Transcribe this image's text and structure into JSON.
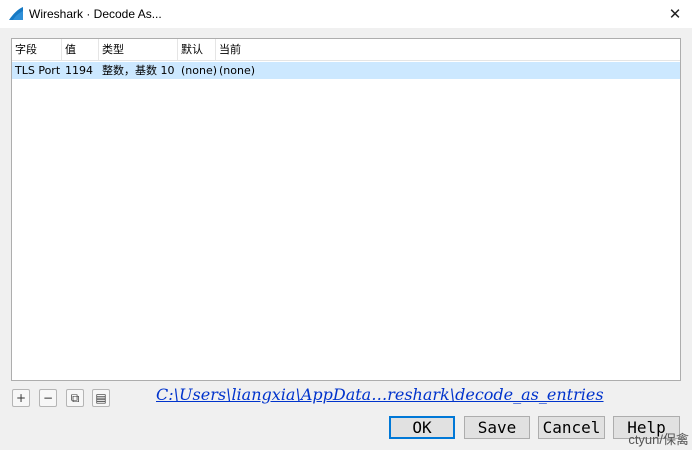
{
  "window": {
    "title": "Wireshark · Decode As...",
    "close_glyph": "✕",
    "app_icon": "wireshark-fin-icon",
    "accent_color": "#0078d7"
  },
  "table": {
    "columns": [
      "字段",
      "值",
      "类型",
      "默认",
      "当前"
    ],
    "rows": [
      {
        "field": "TLS Port",
        "value": "1194",
        "type": "整数，基数 10",
        "default": "(none)",
        "current": "(none)",
        "selected": true
      }
    ],
    "selection_color": "#cce8ff"
  },
  "toolbar": {
    "add_glyph": "+",
    "remove_glyph": "−",
    "copy_glyph": "⧉",
    "clear_glyph": "▤"
  },
  "path_link": "C:\\Users\\liangxia\\AppData…reshark\\decode_as_entries",
  "buttons": {
    "ok": "OK",
    "save": "Save",
    "cancel": "Cancel",
    "help": "Help"
  },
  "watermark": "ctyun/保禽"
}
